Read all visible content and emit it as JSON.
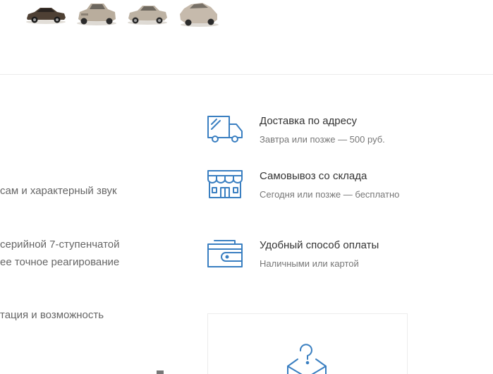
{
  "gallery": {
    "thumbnails": [
      {
        "alt": "car-photo-1",
        "color": "#5a4a3c"
      },
      {
        "alt": "car-photo-2",
        "color": "#b8aa98"
      },
      {
        "alt": "car-photo-3",
        "color": "#bbb0a0"
      },
      {
        "alt": "car-photo-4",
        "color": "#c4b8aa"
      }
    ]
  },
  "description": {
    "lines": [
      "сам и характерный звук",
      "серийной 7-ступенчатой",
      "ее точное реагирование",
      "тация и возможность"
    ]
  },
  "features": [
    {
      "icon": "delivery-truck-icon",
      "title": "Доставка по адресу",
      "subtitle": "Завтра или позже — 500 руб."
    },
    {
      "icon": "store-icon",
      "title": "Самовывоз со склада",
      "subtitle": "Сегодня или позже — бесплатно"
    },
    {
      "icon": "wallet-icon",
      "title": "Удобный способ оплаты",
      "subtitle": "Наличными или картой"
    }
  ],
  "question_box": {
    "icon": "question-envelope-icon"
  },
  "colors": {
    "accent": "#3a7fc1",
    "divider": "#ebebeb",
    "text": "#333333",
    "muted": "#777777"
  }
}
